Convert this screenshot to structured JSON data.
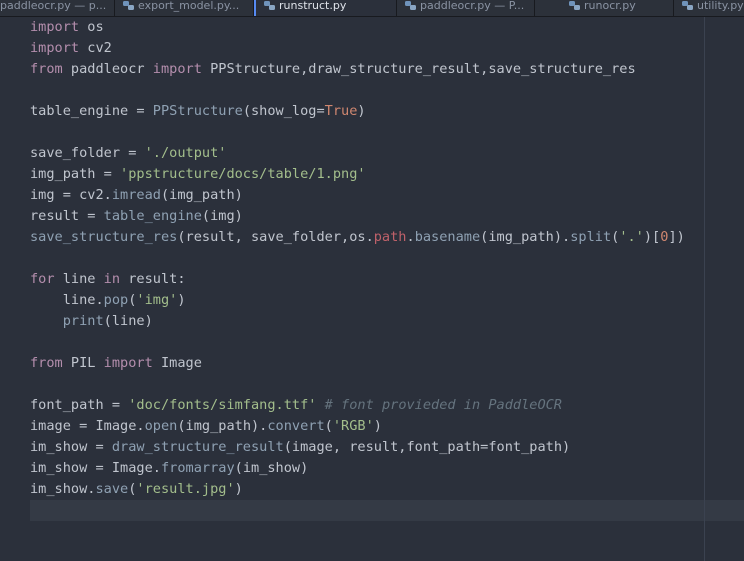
{
  "tabs": [
    {
      "label": "paddleocr.py — p...",
      "active": false
    },
    {
      "label": "export_model.py...",
      "active": false
    },
    {
      "label": "runstruct.py",
      "active": true
    },
    {
      "label": "paddleocr.py — P...",
      "active": false
    },
    {
      "label": "runocr.py",
      "active": false
    },
    {
      "label": "utility.py",
      "active": false
    }
  ],
  "code": {
    "l1": [
      "import",
      " os"
    ],
    "l2": [
      "import",
      " cv2"
    ],
    "l3": [
      "from",
      " paddleocr ",
      "import",
      " PPStructure,draw_structure_result,save_structure_res"
    ],
    "l5": [
      "table_engine ",
      "=",
      " ",
      "PPStructure",
      "(show_log",
      "=",
      "True",
      ")"
    ],
    "l7": [
      "save_folder ",
      "=",
      " ",
      "'./output'"
    ],
    "l8": [
      "img_path ",
      "=",
      " ",
      "'ppstructure/docs/table/1.png'"
    ],
    "l9": [
      "img ",
      "=",
      " cv2.",
      "imread",
      "(img_path)"
    ],
    "l10": [
      "result ",
      "=",
      " ",
      "table_engine",
      "(img)"
    ],
    "l11": [
      "save_structure_res",
      "(result, save_folder,os.",
      "path",
      ".",
      "basename",
      "(img_path).",
      "split",
      "(",
      "'.'",
      ")[",
      "0",
      "])"
    ],
    "l13": [
      "for",
      " line ",
      "in",
      " result:"
    ],
    "l14": [
      "    line.",
      "pop",
      "(",
      "'img'",
      ")"
    ],
    "l15": [
      "    ",
      "print",
      "(line)"
    ],
    "l17": [
      "from",
      " PIL ",
      "import",
      " Image"
    ],
    "l19": [
      "font_path ",
      "=",
      " ",
      "'doc/fonts/simfang.ttf'",
      " ",
      "# font provieded in PaddleOCR"
    ],
    "l20": [
      "image ",
      "=",
      " Image.",
      "open",
      "(img_path).",
      "convert",
      "(",
      "'RGB'",
      ")"
    ],
    "l21": [
      "im_show ",
      "=",
      " ",
      "draw_structure_result",
      "(image, result,font_path",
      "=",
      "font_path)"
    ],
    "l22": [
      "im_show ",
      "=",
      " Image.",
      "fromarray",
      "(im_show)"
    ],
    "l23": [
      "im_show.",
      "save",
      "(",
      "'result.jpg'",
      ")"
    ]
  },
  "colors": {
    "background": "#2b303b",
    "keyword": "#b48ead",
    "string": "#a3be8c",
    "function": "#8fa1b3",
    "constant": "#d08770",
    "comment": "#65737e",
    "tab_active_accent": "#568af2"
  },
  "icons": {
    "tab_file": "python-file-icon"
  }
}
